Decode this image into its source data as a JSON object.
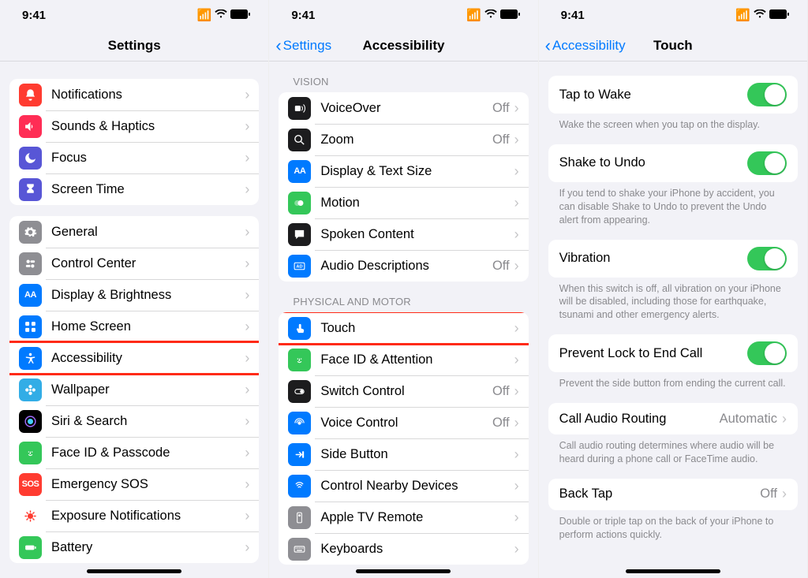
{
  "status": {
    "time": "9:41"
  },
  "screens": [
    {
      "title": "Settings",
      "back": null,
      "groups": [
        {
          "header": null,
          "rows": [
            {
              "icon": "bell",
              "iconBg": "bg-red",
              "label": "Notifications"
            },
            {
              "icon": "speaker",
              "iconBg": "bg-pink",
              "label": "Sounds & Haptics"
            },
            {
              "icon": "moon",
              "iconBg": "bg-purple",
              "label": "Focus"
            },
            {
              "icon": "hourglass",
              "iconBg": "bg-purple",
              "label": "Screen Time"
            }
          ]
        },
        {
          "header": null,
          "rows": [
            {
              "icon": "gear",
              "iconBg": "bg-gray",
              "label": "General"
            },
            {
              "icon": "switches",
              "iconBg": "bg-gray",
              "label": "Control Center"
            },
            {
              "icon": "AA",
              "iconBg": "bg-blue",
              "label": "Display & Brightness"
            },
            {
              "icon": "grid",
              "iconBg": "bg-blue",
              "label": "Home Screen"
            },
            {
              "icon": "accessibility",
              "iconBg": "bg-blue",
              "label": "Accessibility",
              "highlight": true
            },
            {
              "icon": "flower",
              "iconBg": "bg-teal",
              "label": "Wallpaper"
            },
            {
              "icon": "siri",
              "iconBg": "bg-black",
              "label": "Siri & Search"
            },
            {
              "icon": "faceid",
              "iconBg": "bg-green",
              "label": "Face ID & Passcode"
            },
            {
              "icon": "SOS",
              "iconBg": "bg-red",
              "label": "Emergency SOS"
            },
            {
              "icon": "virus",
              "iconBg": "",
              "label": "Exposure Notifications",
              "iconColor": "#ff3b30"
            },
            {
              "icon": "battery",
              "iconBg": "bg-green",
              "label": "Battery"
            }
          ]
        }
      ]
    },
    {
      "title": "Accessibility",
      "back": "Settings",
      "groups": [
        {
          "header": "VISION",
          "rows": [
            {
              "icon": "voiceover",
              "iconBg": "bg-dark",
              "label": "VoiceOver",
              "value": "Off"
            },
            {
              "icon": "zoom",
              "iconBg": "bg-dark",
              "label": "Zoom",
              "value": "Off"
            },
            {
              "icon": "AA",
              "iconBg": "bg-blue",
              "label": "Display & Text Size"
            },
            {
              "icon": "motion",
              "iconBg": "bg-green",
              "label": "Motion"
            },
            {
              "icon": "bubble",
              "iconBg": "bg-dark",
              "label": "Spoken Content"
            },
            {
              "icon": "ad",
              "iconBg": "bg-blue",
              "label": "Audio Descriptions",
              "value": "Off"
            }
          ]
        },
        {
          "header": "PHYSICAL AND MOTOR",
          "rows": [
            {
              "icon": "touch",
              "iconBg": "bg-blue",
              "label": "Touch",
              "highlight": true
            },
            {
              "icon": "faceid",
              "iconBg": "bg-green",
              "label": "Face ID & Attention"
            },
            {
              "icon": "switch",
              "iconBg": "bg-dark",
              "label": "Switch Control",
              "value": "Off"
            },
            {
              "icon": "voice",
              "iconBg": "bg-blue",
              "label": "Voice Control",
              "value": "Off"
            },
            {
              "icon": "side",
              "iconBg": "bg-blue",
              "label": "Side Button"
            },
            {
              "icon": "nearby",
              "iconBg": "bg-blue",
              "label": "Control Nearby Devices"
            },
            {
              "icon": "remote",
              "iconBg": "bg-gray",
              "label": "Apple TV Remote"
            },
            {
              "icon": "keyboard",
              "iconBg": "bg-gray",
              "label": "Keyboards"
            }
          ]
        }
      ]
    },
    {
      "title": "Touch",
      "back": "Accessibility",
      "items": [
        {
          "type": "toggle",
          "label": "Tap to Wake",
          "on": true,
          "footer": "Wake the screen when you tap on the display."
        },
        {
          "type": "toggle",
          "label": "Shake to Undo",
          "on": true,
          "footer": "If you tend to shake your iPhone by accident, you can disable Shake to Undo to prevent the Undo alert from appearing."
        },
        {
          "type": "toggle",
          "label": "Vibration",
          "on": true,
          "footer": "When this switch is off, all vibration on your iPhone will be disabled, including those for earthquake, tsunami and other emergency alerts."
        },
        {
          "type": "toggle",
          "label": "Prevent Lock to End Call",
          "on": true,
          "highlight": true,
          "footer": "Prevent the side button from ending the current call."
        },
        {
          "type": "nav",
          "label": "Call Audio Routing",
          "value": "Automatic",
          "footer": "Call audio routing determines where audio will be heard during a phone call or FaceTime audio."
        },
        {
          "type": "nav",
          "label": "Back Tap",
          "value": "Off",
          "footer": "Double or triple tap on the back of your iPhone to perform actions quickly."
        }
      ]
    }
  ]
}
